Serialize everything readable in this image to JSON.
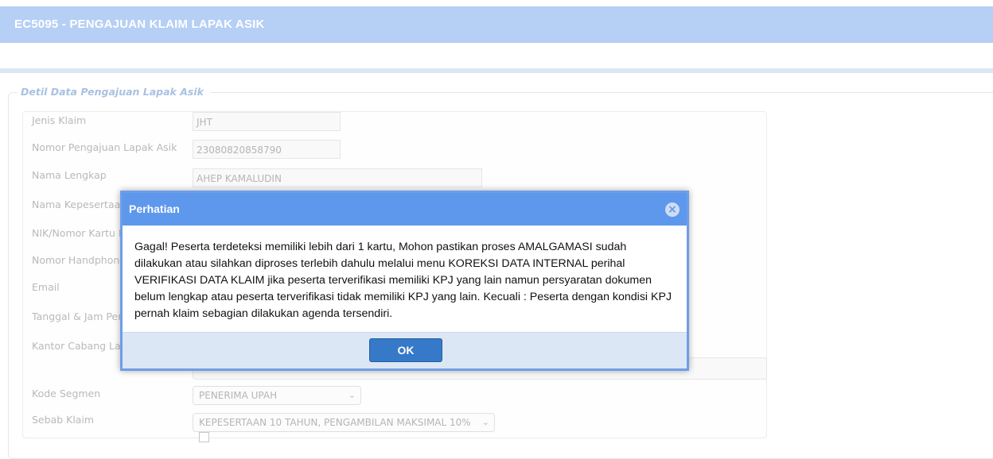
{
  "header": {
    "title": "EC5095 - PENGAJUAN KLAIM LAPAK ASIK"
  },
  "section": {
    "legend": "Detil Data Pengajuan Lapak Asik"
  },
  "form": {
    "jenis_klaim": {
      "label": "Jenis Klaim",
      "value": "JHT"
    },
    "nomor_pengajuan": {
      "label": "Nomor Pengajuan Lapak Asik",
      "value": "23080820858790"
    },
    "nama_lengkap": {
      "label": "Nama Lengkap",
      "value": "AHEP KAMALUDIN"
    },
    "nama_kepesertaan": {
      "label": "Nama Kepesertaan B"
    },
    "nik": {
      "label": "NIK/Nomor Kartu Pes"
    },
    "handphone": {
      "label": "Nomor Handphone"
    },
    "email": {
      "label": "Email"
    },
    "tanggal_jam": {
      "label": "Tanggal & Jam Penga"
    },
    "kantor_cabang": {
      "label": "Kantor Cabang Layan"
    },
    "kode_segmen": {
      "label": "Kode Segmen",
      "value": "PENERIMA UPAH"
    },
    "sebab_klaim": {
      "label": "Sebab Klaim",
      "value": "KEPESERTAAN 10 TAHUN, PENGAMBILAN MAKSIMAL 10%"
    }
  },
  "dialog": {
    "title": "Perhatian",
    "close_icon": "close-icon",
    "message": "Gagal! Peserta terdeteksi memiliki lebih dari 1 kartu, Mohon pastikan proses AMALGAMASI sudah dilakukan atau silahkan diproses terlebih dahulu melalui menu KOREKSI DATA INTERNAL perihal VERIFIKASI DATA KLAIM jika peserta terverifikasi memiliki KPJ yang lain namun persyaratan dokumen belum lengkap atau peserta terverifikasi tidak memiliki KPJ yang lain. Kecuali : Peserta dengan kondisi KPJ pernah klaim sebagian dilakukan agenda tersendiri.",
    "ok_label": "OK"
  },
  "colors": {
    "header": "#b5cff5",
    "dialog_header": "#5e98ec",
    "ok_button": "#3579c8"
  }
}
